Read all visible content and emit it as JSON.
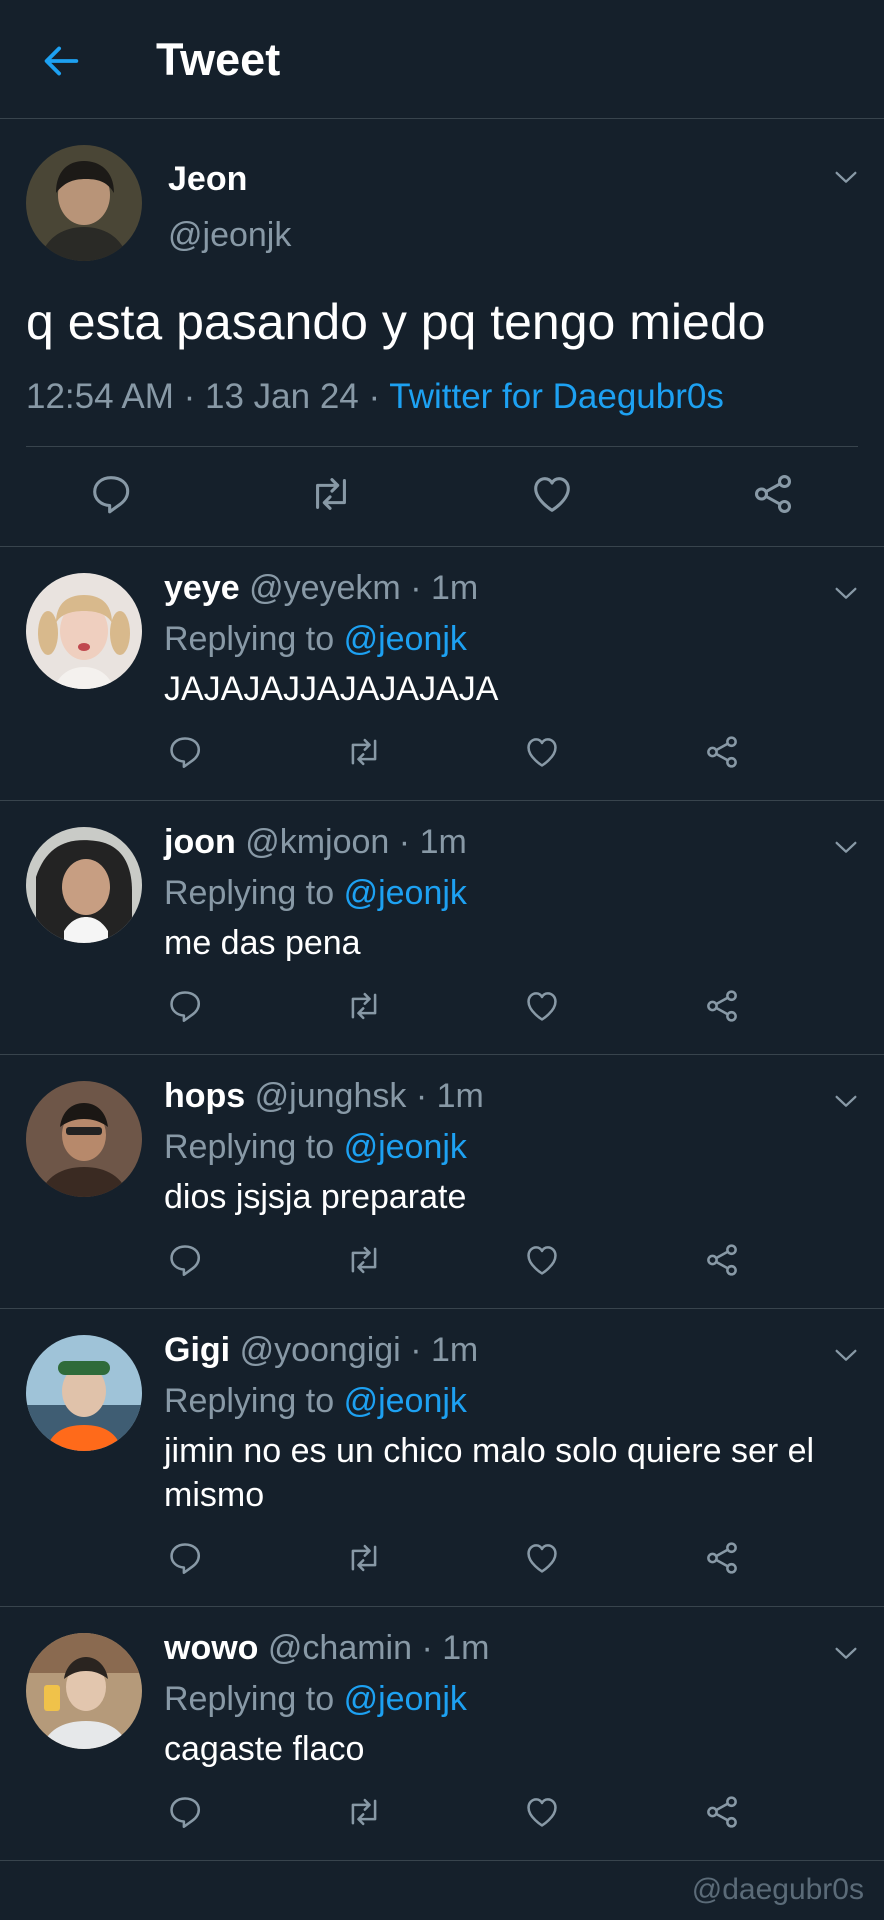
{
  "header": {
    "title": "Tweet",
    "back_icon": "arrow-left-icon"
  },
  "colors": {
    "background": "#15202b",
    "accent": "#1da1f2",
    "muted": "#8899a6",
    "divider": "#38444d"
  },
  "tweet": {
    "name": "Jeon",
    "handle": "@jeonjk",
    "text": "q esta pasando y pq tengo miedo",
    "time": "12:54 AM",
    "date": "13 Jan 24",
    "source": "Twitter for Daegubr0s",
    "sep": "·"
  },
  "replies": [
    {
      "name": "yeye",
      "handle": "@yeyekm",
      "time": "1m",
      "replying_label": "Replying to",
      "replying_to": "@jeonjk",
      "text": "JAJAJAJJAJAJAJAJA"
    },
    {
      "name": "joon",
      "handle": "@kmjoon",
      "time": "1m",
      "replying_label": "Replying to",
      "replying_to": "@jeonjk",
      "text": "me das pena"
    },
    {
      "name": "hops",
      "handle": "@junghsk",
      "time": "1m",
      "replying_label": "Replying to",
      "replying_to": "@jeonjk",
      "text": "dios jsjsja preparate"
    },
    {
      "name": "Gigi",
      "handle": "@yoongigi",
      "time": "1m",
      "replying_label": "Replying to",
      "replying_to": "@jeonjk",
      "text": "jimin no es un chico malo solo quiere ser el mismo"
    },
    {
      "name": "wowo",
      "handle": "@chamin",
      "time": "1m",
      "replying_label": "Replying to",
      "replying_to": "@jeonjk",
      "text": "cagaste flaco"
    }
  ],
  "icons": [
    "reply-icon",
    "retweet-icon",
    "like-icon",
    "share-icon",
    "chevron-down-icon"
  ],
  "watermark": "@daegubr0s"
}
